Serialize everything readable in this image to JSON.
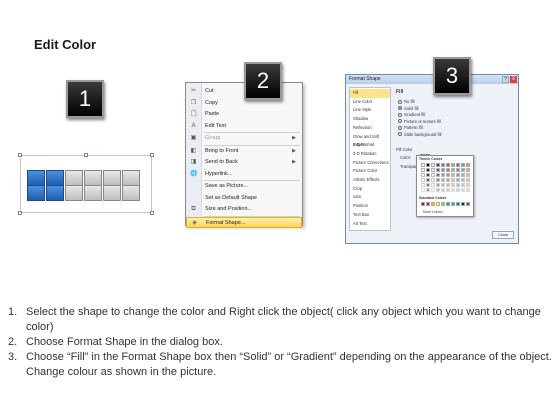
{
  "title": "Edit Color",
  "badges": [
    "1",
    "2",
    "3"
  ],
  "context_menu": {
    "items": [
      {
        "label": "Cut",
        "icon": "scissors-icon",
        "glyph": "✂"
      },
      {
        "label": "Copy",
        "icon": "copy-icon",
        "glyph": "❐"
      },
      {
        "label": "Paste",
        "icon": "paste-icon",
        "glyph": "📋"
      },
      {
        "label": "Edit Text",
        "icon": "edit-text-icon",
        "glyph": "A"
      },
      {
        "label": "Group",
        "icon": "group-icon",
        "glyph": "▣",
        "disabled": true,
        "submenu": true
      },
      {
        "label": "Bring to Front",
        "icon": "bring-to-front-icon",
        "glyph": "◧",
        "submenu": true
      },
      {
        "label": "Send to Back",
        "icon": "send-to-back-icon",
        "glyph": "◨",
        "submenu": true
      },
      {
        "label": "Hyperlink...",
        "icon": "hyperlink-icon",
        "glyph": "🌐"
      },
      {
        "label": "Save as Picture...",
        "icon": "",
        "glyph": ""
      },
      {
        "label": "Set as Default Shape",
        "icon": "",
        "glyph": ""
      },
      {
        "label": "Size and Position...",
        "icon": "size-position-icon",
        "glyph": "⧉"
      },
      {
        "label": "Format Shape...",
        "icon": "format-shape-icon",
        "glyph": "◈",
        "highlighted": true
      }
    ]
  },
  "format_dialog": {
    "title": "Format Shape",
    "help": "?",
    "close_x": "X",
    "categories": [
      "Fill",
      "Line Color",
      "Line Style",
      "Shadow",
      "Reflection",
      "Glow and Soft Edges",
      "3-D Format",
      "3-D Rotation",
      "Picture Corrections",
      "Picture Color",
      "Artistic Effects",
      "Crop",
      "Size",
      "Position",
      "Text Box",
      "Alt Text"
    ],
    "selected_category": "Fill",
    "section": "Fill",
    "options": [
      "No fill",
      "Solid fill",
      "Gradient fill",
      "Picture or texture fill",
      "Pattern fill",
      "Slide background fill"
    ],
    "selected_option": "Solid fill",
    "fill_color_label": "Fill Color",
    "color_label": "Color:",
    "transparency_label": "Transparency:",
    "close_label": "Close",
    "palette": {
      "theme_label": "Theme Colors",
      "standard_label": "Standard Colors",
      "more_label": "More Colors...",
      "theme_colors": [
        "#ffffff",
        "#000000",
        "#eeece1",
        "#1f497d",
        "#4f81bd",
        "#c0504d",
        "#9bbb59",
        "#8064a2",
        "#4bacc6",
        "#f79646"
      ],
      "standard_colors": [
        "#c00000",
        "#ff0000",
        "#ffc000",
        "#ffff00",
        "#92d050",
        "#00b050",
        "#00b0f0",
        "#0070c0",
        "#002060",
        "#7030a0"
      ]
    }
  },
  "instructions": [
    {
      "num": "1.",
      "text": "Select the shape to change the color and Right click the object( click any object which you want to change color)"
    },
    {
      "num": "2.",
      "text": "Choose Format Shape in the dialog box."
    },
    {
      "num": "3.",
      "text": "Choose “Fill” in the Format Shape box then “Solid” or “Gradient” depending on the appearance of the object. Change colour as shown in the picture."
    }
  ],
  "colors": {
    "accent_blue": "#1f5fb0",
    "highlight": "#ffd35c",
    "badge": "#000000"
  }
}
